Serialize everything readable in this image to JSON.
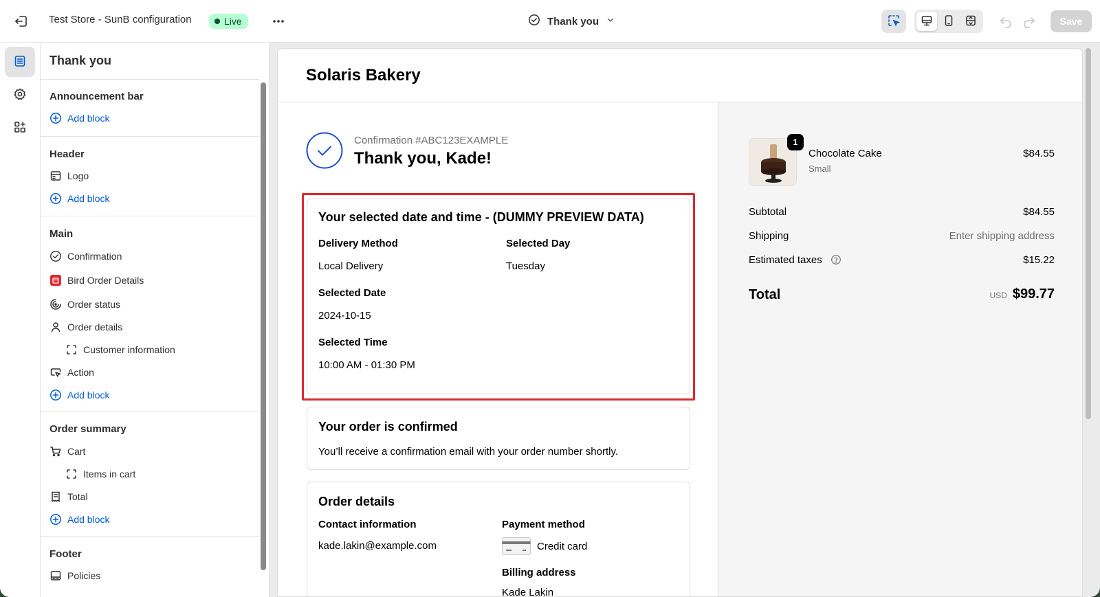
{
  "topbar": {
    "store_title": "Test Store - SunB configuration",
    "status": "Live",
    "page_selector": "Thank you",
    "save_label": "Save"
  },
  "sidebar": {
    "heading": "Thank you",
    "sections": {
      "announcement": {
        "title": "Announcement bar",
        "add": "Add block"
      },
      "header": {
        "title": "Header",
        "logo": "Logo",
        "add": "Add block"
      },
      "main": {
        "title": "Main",
        "confirmation": "Confirmation",
        "bird_order_details": "Bird Order Details",
        "order_status": "Order status",
        "order_details": "Order details",
        "customer_information": "Customer information",
        "action": "Action",
        "add": "Add block"
      },
      "order_summary": {
        "title": "Order summary",
        "cart": "Cart",
        "items_in_cart": "Items in cart",
        "total": "Total",
        "add": "Add block"
      },
      "footer": {
        "title": "Footer",
        "policies": "Policies"
      }
    }
  },
  "preview": {
    "store_name": "Solaris Bakery",
    "confirmation_number": "Confirmation #ABC123EXAMPLE",
    "thank_you": "Thank you, Kade!",
    "selected_card": {
      "title": "Your selected date and time - (DUMMY PREVIEW DATA)",
      "delivery_method_label": "Delivery Method",
      "delivery_method_value": "Local Delivery",
      "selected_day_label": "Selected Day",
      "selected_day_value": "Tuesday",
      "selected_date_label": "Selected Date",
      "selected_date_value": "2024-10-15",
      "selected_time_label": "Selected Time",
      "selected_time_value": "10:00 AM - 01:30 PM"
    },
    "order_confirmed": {
      "title": "Your order is confirmed",
      "message": "You’ll receive a confirmation email with your order number shortly."
    },
    "order_details": {
      "title": "Order details",
      "contact_label": "Contact information",
      "contact_value": "kade.lakin@example.com",
      "payment_label": "Payment method",
      "payment_value": "Credit card",
      "billing_label": "Billing address",
      "billing_value": "Kade Lakin"
    },
    "summary": {
      "item_name": "Chocolate Cake",
      "item_variant": "Small",
      "item_price": "$84.55",
      "item_qty": "1",
      "subtotal_label": "Subtotal",
      "subtotal_value": "$84.55",
      "shipping_label": "Shipping",
      "shipping_value": "Enter shipping address",
      "taxes_label": "Estimated taxes",
      "taxes_value": "$15.22",
      "total_label": "Total",
      "total_currency": "USD",
      "total_value": "$99.77"
    }
  },
  "colors": {
    "accent": "#005bd3",
    "highlight": "#e1272f",
    "live_bg": "#b4fed2",
    "live_text": "#0c5132"
  }
}
